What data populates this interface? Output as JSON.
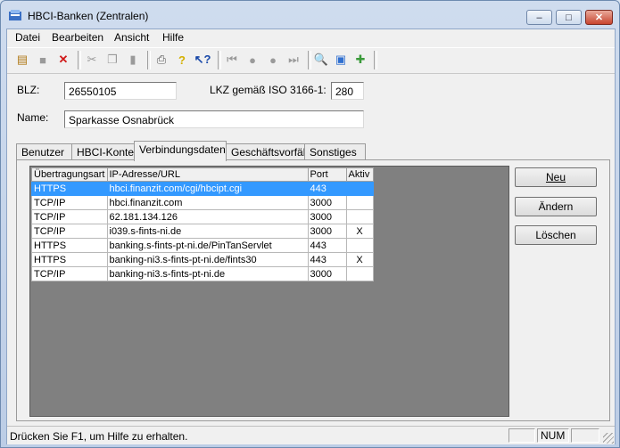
{
  "window": {
    "title": "HBCI-Banken (Zentralen)",
    "controls": {
      "minimize": "–",
      "maximize": "□",
      "close": "✕"
    }
  },
  "menu": [
    "Datei",
    "Bearbeiten",
    "Ansicht",
    "Hilfe"
  ],
  "toolbar": {
    "icons": [
      "new-record-icon",
      "save-icon",
      "delete-icon",
      "cut-icon",
      "copy-icon",
      "paste-icon",
      "print-icon",
      "help-icon",
      "context-help-icon",
      "first-record-icon",
      "prev-record-icon",
      "next-record-icon",
      "last-record-icon",
      "find-icon",
      "image-icon",
      "puzzle-icon"
    ]
  },
  "form": {
    "blz_label": "BLZ:",
    "blz_value": "26550105",
    "lkz_label": "LKZ gemäß ISO 3166-1:",
    "lkz_value": "280",
    "name_label": "Name:",
    "name_value": "Sparkasse Osnabrück"
  },
  "tabs": [
    "Benutzer",
    "HBCI-Konten",
    "Verbindungsdaten",
    "Geschäftsvorfälle",
    "Sonstiges"
  ],
  "active_tab": "Verbindungsdaten",
  "table": {
    "columns": [
      "Übertragungsart",
      "IP-Adresse/URL",
      "Port",
      "Aktiv"
    ],
    "rows": [
      [
        "HTTPS",
        "hbci.finanzit.com/cgi/hbcipt.cgi",
        "443",
        ""
      ],
      [
        "TCP/IP",
        "hbci.finanzit.com",
        "3000",
        ""
      ],
      [
        "TCP/IP",
        "62.181.134.126",
        "3000",
        ""
      ],
      [
        "TCP/IP",
        "i039.s-fints-ni.de",
        "3000",
        "X"
      ],
      [
        "HTTPS",
        "banking.s-fints-pt-ni.de/PinTanServlet",
        "443",
        ""
      ],
      [
        "HTTPS",
        "banking-ni3.s-fints-pt-ni.de/fints30",
        "443",
        "X"
      ],
      [
        "TCP/IP",
        "banking-ni3.s-fints-pt-ni.de",
        "3000",
        ""
      ]
    ]
  },
  "buttons": {
    "new": "Neu",
    "edit": "Ändern",
    "delete": "Löschen"
  },
  "status": {
    "text": "Drücken Sie F1, um Hilfe zu erhalten.",
    "num": "NUM"
  }
}
